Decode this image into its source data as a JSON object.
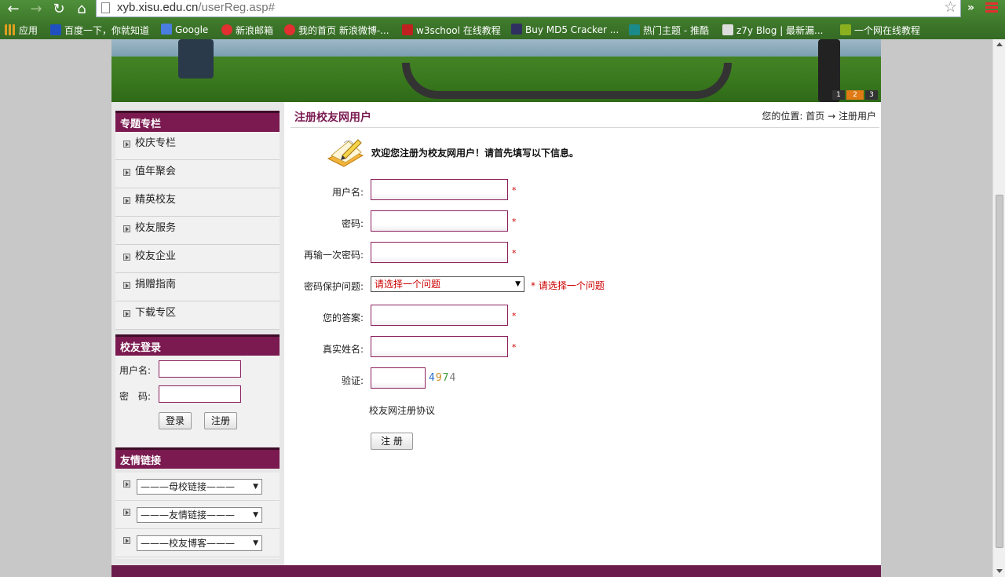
{
  "browser": {
    "url_host": "xyb.xisu.edu.cn",
    "url_path": "/userReg.asp#",
    "ext_label": "»",
    "icons": [
      "back-icon",
      "forward-icon",
      "reload-icon",
      "home-icon",
      "star-icon",
      "menu-icon"
    ],
    "bookmarks": [
      {
        "label": "应用",
        "color": "#e0a020"
      },
      {
        "label": "百度一下，你就知道",
        "color": "#2050c0"
      },
      {
        "label": "Google",
        "color": "#4a7de0"
      },
      {
        "label": "新浪邮箱",
        "color": "#e03030"
      },
      {
        "label": "我的首页 新浪微博-...",
        "color": "#e03030"
      },
      {
        "label": "w3school 在线教程",
        "color": "#c02020"
      },
      {
        "label": "Buy MD5 Cracker ...",
        "color": "#303060"
      },
      {
        "label": "热门主题 - 推酷",
        "color": "#1a8a8a"
      },
      {
        "label": "z7y Blog | 最新漏...",
        "color": "#dddddd"
      },
      {
        "label": "一个网在线教程",
        "color": "#8ab020"
      }
    ]
  },
  "banner": {
    "pager": [
      "1",
      "2",
      "3"
    ]
  },
  "sidebar": {
    "topics_title": "专题专栏",
    "topics": [
      "校庆专栏",
      "值年聚会",
      "精英校友",
      "校友服务",
      "校友企业",
      "捐赠指南",
      "下载专区"
    ],
    "login_title": "校友登录",
    "username_label": "用户名:",
    "password_label": "密　码:",
    "login_button": "登录",
    "register_button": "注册",
    "links_title": "友情链接",
    "link_selects": [
      "———母校链接———",
      "———友情链接———",
      "———校友博客———"
    ]
  },
  "main": {
    "title": "注册校友网用户",
    "breadcrumb_prefix": "您的位置:",
    "breadcrumb_home": "首页",
    "breadcrumb_arrow": "→",
    "breadcrumb_current": "注册用户",
    "welcome": "欢迎您注册为校友网用户！请首先填写以下信息。",
    "fields": {
      "username": "用户名:",
      "password": "密码:",
      "confirm": "再输一次密码:",
      "question": "密码保护问题:",
      "answer": "您的答案:",
      "realname": "真实姓名:",
      "verify": "验证:"
    },
    "required_mark": "*",
    "question_value": "请选择一个问题",
    "question_hint": "* 请选择一个问题",
    "captcha": "4974",
    "captcha_colors": [
      "#2a6fd0",
      "#c98a1a",
      "#3a9a3a",
      "#7a7a7a"
    ],
    "agreement": "校友网注册协议",
    "submit": "注 册"
  }
}
